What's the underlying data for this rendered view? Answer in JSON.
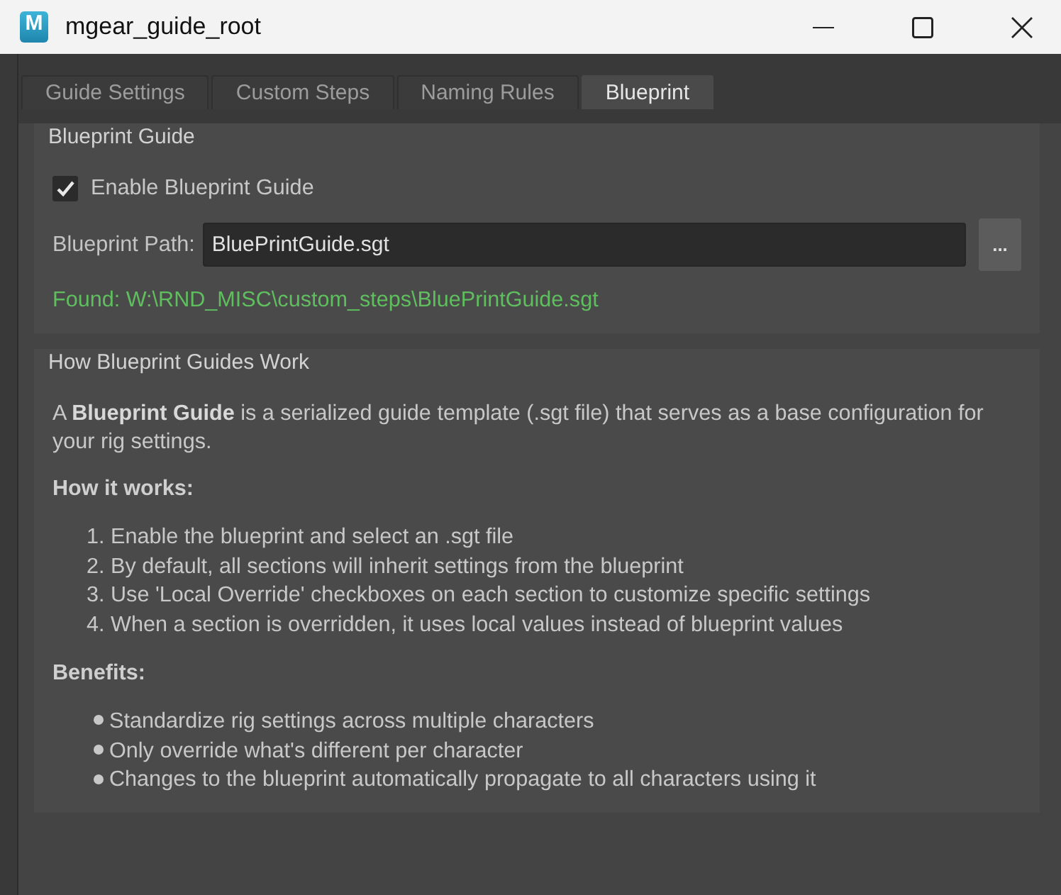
{
  "window": {
    "title": "mgear_guide_root",
    "icon_letter": "M"
  },
  "tabs": [
    {
      "label": "Guide Settings",
      "selected": false
    },
    {
      "label": "Custom Steps",
      "selected": false
    },
    {
      "label": "Naming Rules",
      "selected": false
    },
    {
      "label": "Blueprint",
      "selected": true
    }
  ],
  "blueprint_guide": {
    "title": "Blueprint Guide",
    "enable": {
      "label": "Enable Blueprint Guide",
      "checked": true
    },
    "path": {
      "label": "Blueprint Path:",
      "value": "BluePrintGuide.sgt",
      "browse_button": "..."
    },
    "status": {
      "kind": "found",
      "text": "Found: W:\\RND_MISC\\custom_steps\\BluePrintGuide.sgt"
    }
  },
  "help": {
    "title": "How Blueprint Guides Work",
    "intro": "A **Blueprint Guide** is a serialized guide template (.sgt file) that serves as a base configuration for your rig settings.",
    "sections": [
      {
        "kind": "numbered",
        "heading": "How it works:",
        "items": [
          "1. Enable the blueprint and select an .sgt file",
          "2. By default, all sections will inherit settings from the blueprint",
          "3. Use 'Local Override' checkboxes on each section to customize specific settings",
          "4. When a section is overridden, it uses local values instead of blueprint values"
        ]
      },
      {
        "kind": "bullet",
        "heading": "Benefits:",
        "items": [
          "Standardize rig settings across multiple characters",
          "Only override what's different per character",
          "Changes to the blueprint automatically propagate to all characters using it"
        ]
      }
    ]
  }
}
